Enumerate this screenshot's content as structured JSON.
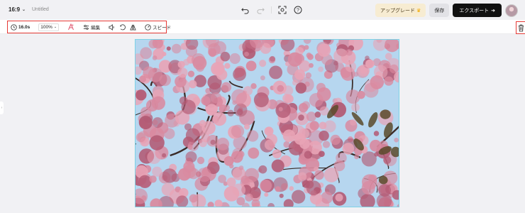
{
  "topbar": {
    "ratio": "16:9",
    "title": "Untitled",
    "center_icons": [
      "undo-icon",
      "redo-icon",
      "screenshot-icon",
      "help-icon"
    ],
    "upgrade_label": "アップグレード",
    "save_label": "保存",
    "export_label": "エクスポート"
  },
  "toolbar": {
    "duration": "16.0s",
    "zoom": "100%",
    "edit_label": "編集",
    "speed_label": "スピード",
    "icons": [
      "clock-icon",
      "magic-text-icon",
      "sliders-icon",
      "volume-icon",
      "rotate-icon",
      "flip-icon",
      "speedometer-icon",
      "trash-icon"
    ]
  },
  "canvas": {
    "content": "photo",
    "colors": {
      "sky": "#b6d6ef",
      "blossom": "#d98aa0",
      "blossom_dark": "#b35a74",
      "branch": "#3a2a26",
      "leaf": "#5a4a2a"
    }
  },
  "colors": {
    "highlight": "#e53935",
    "accent": "#7dd3e6",
    "export_bg": "#111111",
    "upgrade_bg": "#f7ecd2"
  }
}
